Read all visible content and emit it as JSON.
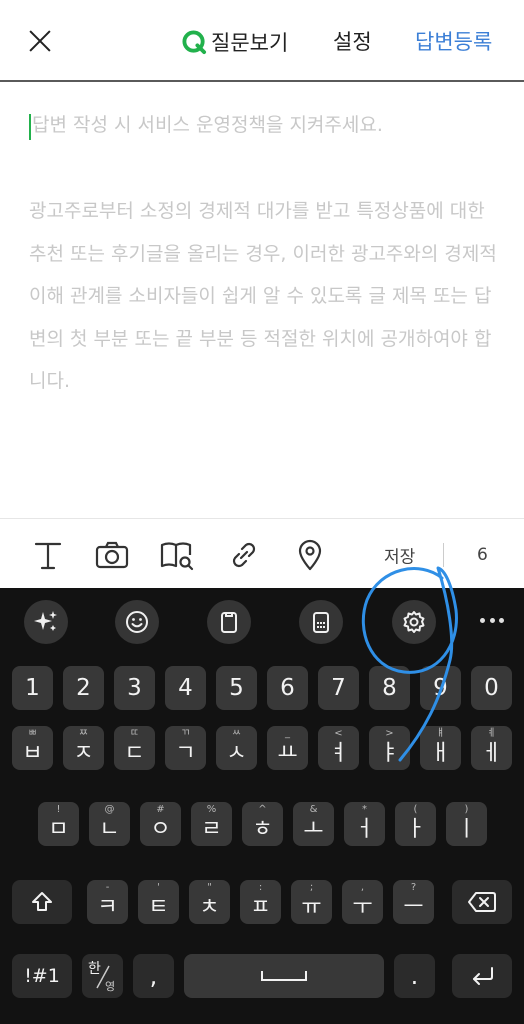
{
  "header": {
    "view_question": "질문보기",
    "settings": "설정",
    "submit": "답변등록"
  },
  "editor": {
    "placeholder_line1": "답변 작성 시 서비스 운영정책을 지켜주세요.",
    "placeholder_notice": "광고주로부터 소정의 경제적 대가를 받고 특정상품에 대한 추천 또는 후기글을 올리는 경우, 이러한 광고주와의 경제적 이해 관계를 소비자들이 쉽게 알 수 있도록 글 제목 또는 답변의 첫 부분 또는 끝 부분 등 적절한 위치에 공개하여야 합니다."
  },
  "toolbar": {
    "save": "저장",
    "count": "6",
    "icons": [
      "text-icon",
      "camera-icon",
      "book-search-icon",
      "link-icon",
      "location-pin-icon"
    ]
  },
  "keyboard": {
    "tools": [
      "sparkle-icon",
      "emoji-icon",
      "clipboard-icon",
      "keyboard-mode-icon",
      "gear-icon",
      "more-icon"
    ],
    "numbers": [
      "1",
      "2",
      "3",
      "4",
      "5",
      "6",
      "7",
      "8",
      "9",
      "0"
    ],
    "row1": [
      {
        "main": "ㅂ",
        "sub": "ㅃ"
      },
      {
        "main": "ㅈ",
        "sub": "ㅉ"
      },
      {
        "main": "ㄷ",
        "sub": "ㄸ"
      },
      {
        "main": "ㄱ",
        "sub": "ㄲ"
      },
      {
        "main": "ㅅ",
        "sub": "ㅆ"
      },
      {
        "main": "ㅛ",
        "sub": "_"
      },
      {
        "main": "ㅕ",
        "sub": "<"
      },
      {
        "main": "ㅑ",
        "sub": ">"
      },
      {
        "main": "ㅐ",
        "sub": "ㅒ"
      },
      {
        "main": "ㅔ",
        "sub": "ㅖ"
      }
    ],
    "row2": [
      {
        "main": "ㅁ",
        "sub": "!"
      },
      {
        "main": "ㄴ",
        "sub": "@"
      },
      {
        "main": "ㅇ",
        "sub": "#"
      },
      {
        "main": "ㄹ",
        "sub": "%"
      },
      {
        "main": "ㅎ",
        "sub": "^"
      },
      {
        "main": "ㅗ",
        "sub": "&"
      },
      {
        "main": "ㅓ",
        "sub": "*"
      },
      {
        "main": "ㅏ",
        "sub": "("
      },
      {
        "main": "ㅣ",
        "sub": ")"
      }
    ],
    "row3": [
      {
        "main": "ㅋ",
        "sub": "-"
      },
      {
        "main": "ㅌ",
        "sub": "'"
      },
      {
        "main": "ㅊ",
        "sub": "\""
      },
      {
        "main": "ㅍ",
        "sub": ":"
      },
      {
        "main": "ㅠ",
        "sub": ";"
      },
      {
        "main": "ㅜ",
        "sub": ","
      },
      {
        "main": "ㅡ",
        "sub": "?"
      }
    ],
    "symbols_key": "!#1",
    "lang_key_top": "한",
    "lang_key_bottom": "영",
    "comma_key": ",",
    "period_key": "."
  },
  "colors": {
    "accent_green": "#22b14c",
    "submit_blue": "#3c7fd6",
    "annotation_blue": "#2f8fe6",
    "keyboard_bg": "#121212",
    "key_bg": "#383838"
  }
}
